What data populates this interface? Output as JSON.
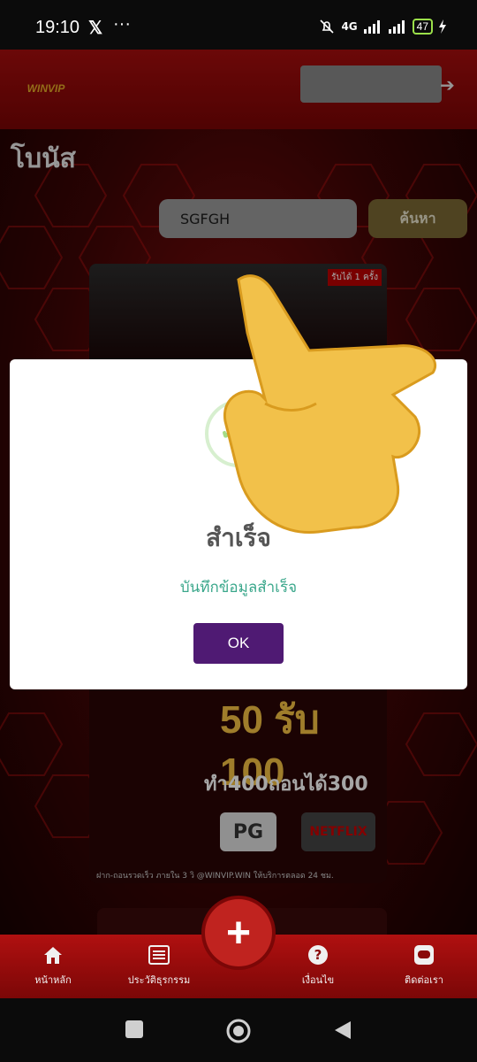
{
  "status_bar": {
    "time": "19:10",
    "x_label": "𝕏",
    "dots": "···",
    "network": "4G",
    "battery": "47"
  },
  "header": {
    "logo_text": "WINVIP"
  },
  "page": {
    "title": "โบนัส"
  },
  "search": {
    "value": "SGFGH",
    "button_label": "ค้นหา"
  },
  "promo": {
    "badge": "รับได้ 1 ครั้ง",
    "big_text": "50 รับ 100",
    "condition": "ทำ400ถอนได้300",
    "pg": "PG",
    "netflix": "NETFLIX",
    "footer": "ฝาก-ถอนรวดเร็ว ภายใน 3 วิ  @WINVIP.WIN  ให้บริการตลอด 24 ชม."
  },
  "dialog": {
    "title": "สำเร็จ",
    "message": "บันทึกข้อมูลสำเร็จ",
    "ok_label": "OK"
  },
  "bottom_nav": {
    "home": "หน้าหลัก",
    "history": "ประวัติธุรกรรม",
    "add": "+",
    "terms": "เงื่อนไข",
    "contact": "ติดต่อเรา"
  },
  "colors": {
    "header_red": "#a50d0d",
    "ok_purple": "#4f1a73",
    "search_gold": "#7a6833",
    "success_text": "#3aa78b"
  }
}
